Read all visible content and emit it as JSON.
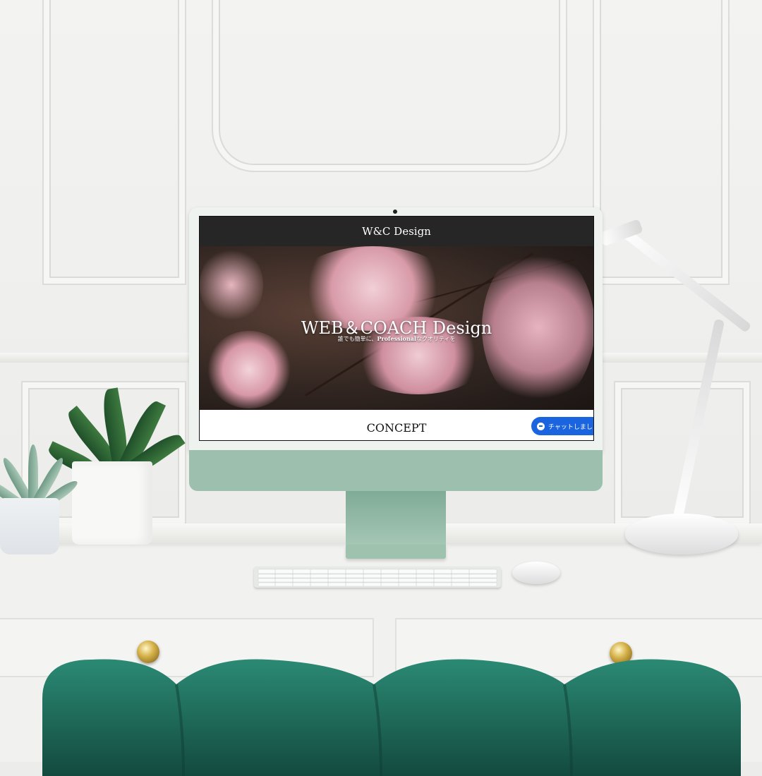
{
  "screen": {
    "brand": "W&C Design",
    "hero_title": "WEB＆COACH Design",
    "hero_sub_prefix": "誰でも簡単に、",
    "hero_sub_bold": "Professional",
    "hero_sub_suffix": "なクオリティを",
    "section_title": "CONCEPT",
    "chat_label": "チャットしまし"
  },
  "colors": {
    "header_bg": "#262626",
    "chat_button": "#1b64e0",
    "monitor_green": "#9dbfae",
    "chair_green": "#1f6b5c"
  }
}
